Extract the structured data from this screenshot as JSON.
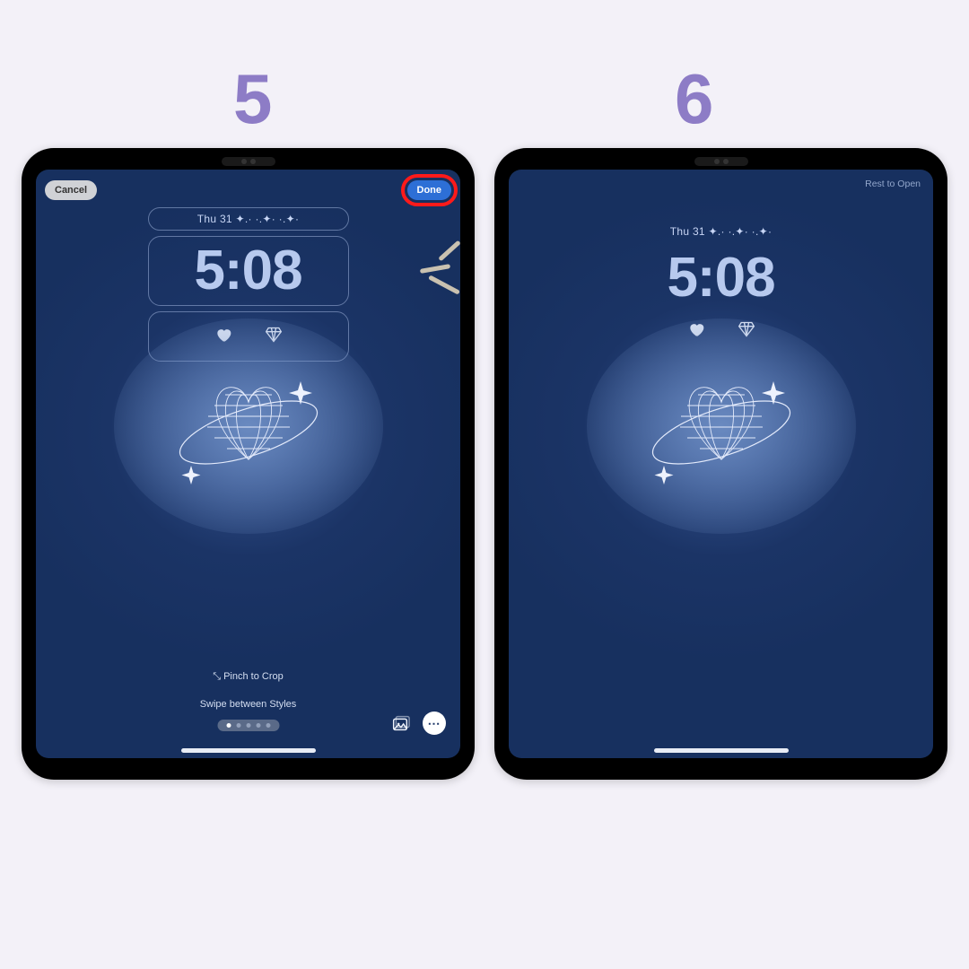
{
  "step_labels": {
    "left": "5",
    "right": "6"
  },
  "colors": {
    "page_bg": "#f3f1f8",
    "step_num": "#8d7cc6",
    "screen_bg": "#1b3466",
    "accent_blue": "#2d6fd6",
    "highlight_ring": "#ff1a1a",
    "time_text": "#b7c9ee"
  },
  "lockscreen": {
    "date": "Thu 31  ✦.·  ·.✦·  ·.✦·",
    "time": "5:08",
    "widgets": [
      "heart-icon",
      "diamond-icon"
    ]
  },
  "editor": {
    "cancel_label": "Cancel",
    "done_label": "Done",
    "pinch_hint": "⤡  Pinch to Crop",
    "styles_hint": "Swipe between Styles",
    "page_count": 5,
    "active_page_index": 0,
    "tools": {
      "photo": "photo-library-icon",
      "more": "⋯"
    }
  },
  "final": {
    "rest_to_open": "Rest to Open"
  }
}
